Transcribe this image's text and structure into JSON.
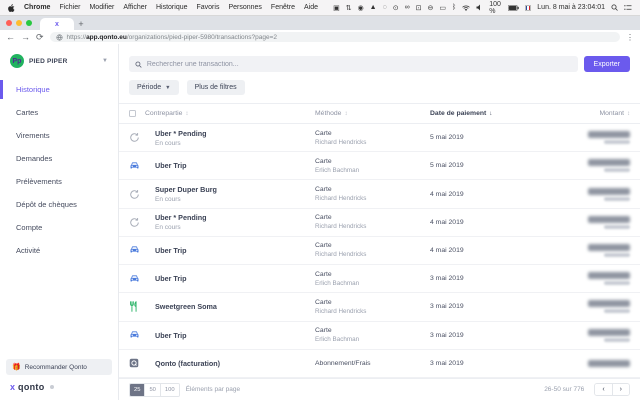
{
  "menubar": {
    "items": [
      "Chrome",
      "Fichier",
      "Modifier",
      "Afficher",
      "Historique",
      "Favoris",
      "Personnes",
      "Fenêtre",
      "Aide"
    ],
    "status_glyphs": [
      "▣",
      "⇅",
      "◉",
      "▲",
      "◌",
      "⊙",
      "∞",
      "⊡",
      "⊖",
      "▭",
      "ᛒ"
    ],
    "battery_label": "100 %",
    "clock": "Lun. 8 mai à 23:04:01"
  },
  "browser": {
    "tab_favicon": "x",
    "new_tab": "+",
    "back": "←",
    "forward": "→",
    "reload": "⟳",
    "url_scheme": "https://",
    "url_host": "app.qonto.eu",
    "url_path": "/organizations/pied-piper-5980/transactions?page=2",
    "menu_dots": "⋮"
  },
  "sidebar": {
    "org_initials": "Pp",
    "org_name": "PIED PIPER",
    "items": [
      {
        "label": "Historique",
        "active": true
      },
      {
        "label": "Cartes",
        "active": false
      },
      {
        "label": "Virements",
        "active": false
      },
      {
        "label": "Demandes",
        "active": false
      },
      {
        "label": "Prélèvements",
        "active": false
      },
      {
        "label": "Dépôt de chèques",
        "active": false
      },
      {
        "label": "Compte",
        "active": false
      },
      {
        "label": "Activité",
        "active": false
      }
    ],
    "recommend_label": "Recommander Qonto",
    "brand_x": "x",
    "brand_name": "qonto"
  },
  "toolbar": {
    "search_placeholder": "Rechercher une transaction...",
    "export_label": "Exporter",
    "periode_label": "Période",
    "more_filters_label": "Plus de filtres"
  },
  "table": {
    "headers": {
      "counterparty": "Contrepartie",
      "method": "Méthode",
      "date": "Date de paiement",
      "amount": "Montant"
    },
    "sorted_column": "date",
    "rows": [
      {
        "icon": "pending",
        "name": "Uber * Pending",
        "status": "En cours",
        "method": "Carte",
        "method_by": "Richard Hendricks",
        "date": "5 mai 2019",
        "amount_redacted": true,
        "amount_lines": 2
      },
      {
        "icon": "car",
        "name": "Uber Trip",
        "status": "",
        "method": "Carte",
        "method_by": "Erlich Bachman",
        "date": "5 mai 2019",
        "amount_redacted": true,
        "amount_lines": 2
      },
      {
        "icon": "pending",
        "name": "Super Duper Burg",
        "status": "En cours",
        "method": "Carte",
        "method_by": "Richard Hendricks",
        "date": "4 mai 2019",
        "amount_redacted": true,
        "amount_lines": 2
      },
      {
        "icon": "pending",
        "name": "Uber * Pending",
        "status": "En cours",
        "method": "Carte",
        "method_by": "Richard Hendricks",
        "date": "4 mai 2019",
        "amount_redacted": true,
        "amount_lines": 2
      },
      {
        "icon": "car",
        "name": "Uber Trip",
        "status": "",
        "method": "Carte",
        "method_by": "Richard Hendricks",
        "date": "4 mai 2019",
        "amount_redacted": true,
        "amount_lines": 2
      },
      {
        "icon": "car",
        "name": "Uber Trip",
        "status": "",
        "method": "Carte",
        "method_by": "Erlich Bachman",
        "date": "3 mai 2019",
        "amount_redacted": true,
        "amount_lines": 2
      },
      {
        "icon": "food",
        "name": "Sweetgreen Soma",
        "status": "",
        "method": "Carte",
        "method_by": "Richard Hendricks",
        "date": "3 mai 2019",
        "amount_redacted": true,
        "amount_lines": 2
      },
      {
        "icon": "car",
        "name": "Uber Trip",
        "status": "",
        "method": "Carte",
        "method_by": "Erlich Bachman",
        "date": "3 mai 2019",
        "amount_redacted": true,
        "amount_lines": 2
      },
      {
        "icon": "qonto",
        "name": "Qonto (facturation)",
        "status": "",
        "method": "Abonnement/Frais",
        "method_by": "",
        "date": "3 mai 2019",
        "amount_redacted": true,
        "amount_lines": 1
      }
    ]
  },
  "footer": {
    "page_sizes": [
      "25",
      "50",
      "100"
    ],
    "selected_page_size": "25",
    "per_page_label": "Éléments par page",
    "range_label": "26-50 sur 776",
    "prev": "‹",
    "next": "›"
  },
  "colors": {
    "accent_purple": "#6b5aed",
    "logo_green": "#21b35f",
    "text_dark": "#3c4356",
    "text_gray": "#9aa0ae"
  }
}
